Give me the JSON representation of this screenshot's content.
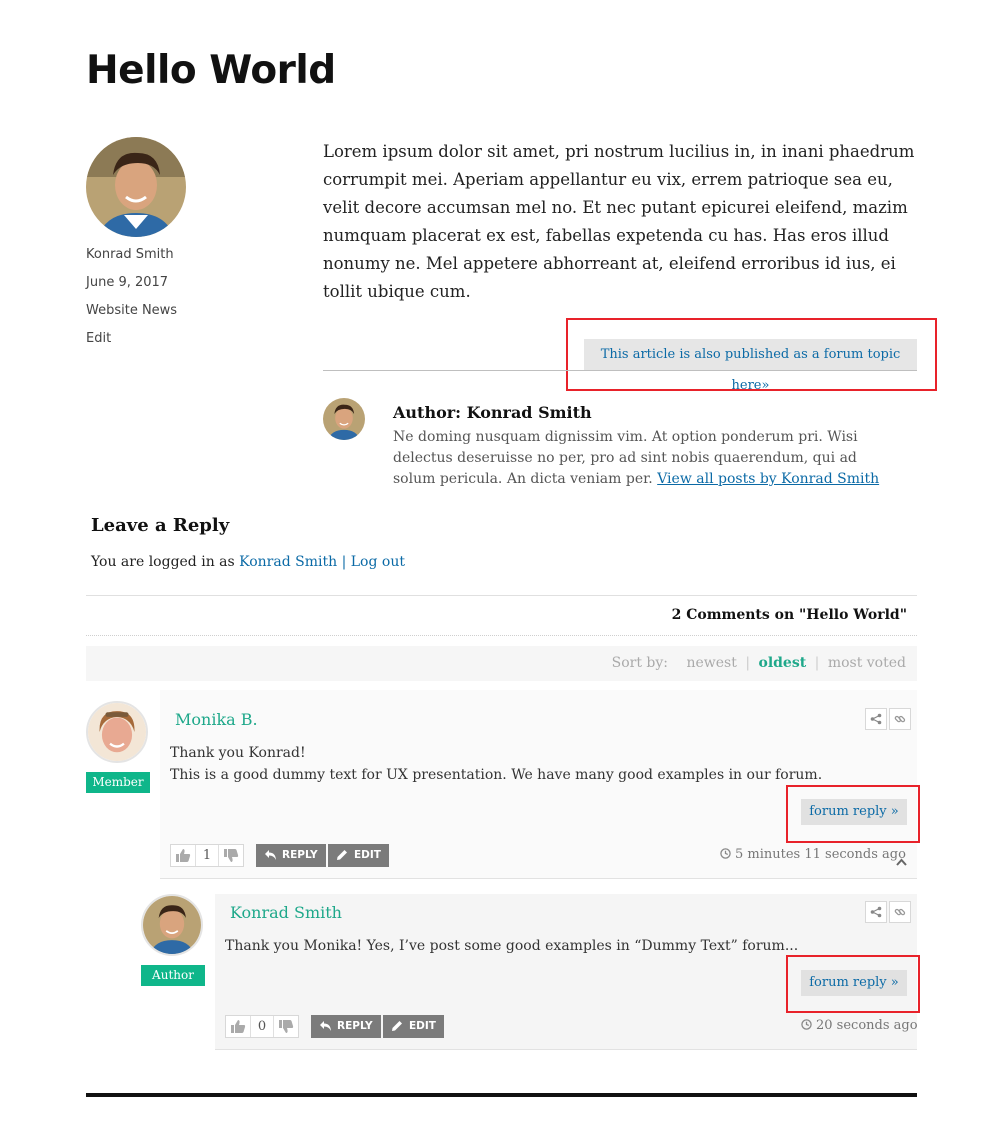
{
  "post": {
    "title": "Hello World",
    "author": "Konrad Smith",
    "date": "June 9, 2017",
    "category": "Website News",
    "edit_label": "Edit",
    "body": "Lorem ipsum dolor sit amet, pri nostrum lucilius in, in inani phaedrum corrumpit mei. Aperiam appellantur eu vix, errem patrioque sea eu, velit decore accumsan mel no. Et nec putant epicurei eleifend, mazim numquam placerat ex est, fabellas expetenda cu has. Has eros illud nonumy ne. Mel appetere abhorreant at, eleifend erroribus id ius, ei tollit ubique cum.",
    "forum_topic_link": "This article is also published as a forum topic here»"
  },
  "author_box": {
    "title": "Author: Konrad Smith",
    "bio": "Ne doming nusquam dignissim vim. At option ponderum pri. Wisi delectus deseruisse no per, pro ad sint nobis quaerendum, qui ad solum pericula. An dicta veniam per.",
    "view_all_link": "View all posts by Konrad Smith"
  },
  "reply": {
    "heading": "Leave a Reply",
    "logged_in_prefix": "You are logged in as",
    "user": "Konrad Smith",
    "separator": "|",
    "logout": "Log out"
  },
  "comments_section": {
    "count_text": "2 Comments on \"Hello World\"",
    "sort_label": "Sort by:",
    "sort_options": [
      "newest",
      "oldest",
      "most voted"
    ],
    "active_sort": "oldest"
  },
  "comments": [
    {
      "name": "Monika B.",
      "badge": "Member",
      "lines": [
        "Thank you Konrad!",
        "This is a good dummy text for UX presentation. We have many good examples in our forum."
      ],
      "forum_reply": "forum reply »",
      "votes": "1",
      "reply_label": "REPLY",
      "edit_label": "EDIT",
      "time": "5 minutes 11 seconds ago"
    },
    {
      "name": "Konrad Smith",
      "badge": "Author",
      "lines": [
        "Thank you Monika! Yes, I’ve post some good examples in “Dummy Text” forum..."
      ],
      "forum_reply": "forum reply »",
      "votes": "0",
      "reply_label": "REPLY",
      "edit_label": "EDIT",
      "time": "20 seconds ago"
    }
  ],
  "colors": {
    "accent_green": "#1ea88a",
    "badge_green": "#0fb68a",
    "link_blue": "#0b6aa6",
    "highlight_red": "#e8222a",
    "action_gray": "#7b7b7b"
  },
  "icons": [
    "share-icon",
    "link-icon",
    "thumbs-up-icon",
    "thumbs-down-icon",
    "reply-icon",
    "pencil-icon",
    "clock-icon",
    "chevron-up-icon"
  ]
}
